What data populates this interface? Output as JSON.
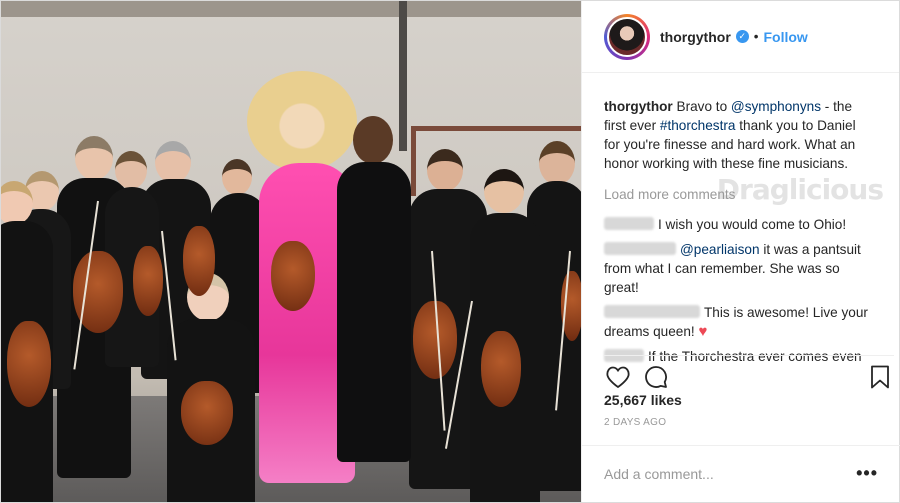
{
  "post": {
    "username": "thorgythor",
    "follow_label": "Follow",
    "caption": {
      "author": "thorgythor",
      "part1": "Bravo to ",
      "mention": "@symphonyns",
      "part2": " - the first ever ",
      "hashtag": "#thorchestra",
      "part3": " thank you to Daniel for you're finesse and hard work. What an honor working with these fine musicians."
    },
    "load_more": "Load more comments",
    "watermark": "Draglicious",
    "comments": [
      {
        "text": "I wish you would come to Ohio!"
      },
      {
        "mention": "@pearliaison",
        "text": " it was a pantsuit from what I can remember. She was so great!"
      },
      {
        "text": "This is awesome! Live your dreams queen!"
      },
      {
        "text": "If the Thorchestra ever comes even"
      }
    ],
    "likes": "25,667 likes",
    "time_ago": "2 DAYS AGO",
    "add_comment_placeholder": "Add a comment...",
    "more_label": "•••"
  },
  "icons": {
    "heart": "heart-icon",
    "comment": "comment-icon",
    "bookmark": "bookmark-icon",
    "verified": "verified-badge-icon"
  },
  "colors": {
    "link_blue": "#3897f0",
    "mention_blue": "#003569",
    "heart_red": "#ed4956"
  }
}
